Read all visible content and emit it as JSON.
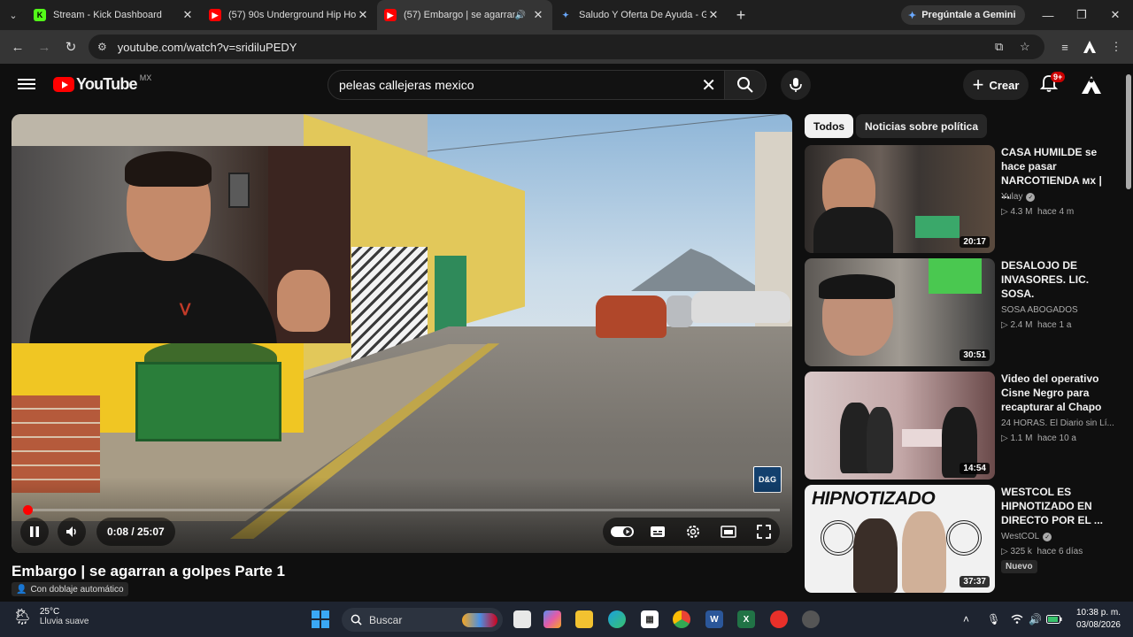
{
  "browser": {
    "tabs": [
      {
        "title": "Stream - Kick Dashboard",
        "favicon": "kick-icon",
        "color": "#53fc18",
        "active": false
      },
      {
        "title": "(57) 90s Underground Hip Hop",
        "favicon": "youtube-icon",
        "color": "#ff0000",
        "active": false
      },
      {
        "title": "(57) Embargo | se agarran a",
        "favicon": "youtube-icon",
        "color": "#ff0000",
        "active": true,
        "audio": true
      },
      {
        "title": "Saludo Y Oferta De Ayuda - Go",
        "favicon": "gemini-icon",
        "color": "#4a90e2",
        "active": false
      }
    ],
    "gemini_label": "Pregúntale a Gemini",
    "url": "youtube.com/watch?v=sridiluPEDY"
  },
  "youtube": {
    "logo_text": "YouTube",
    "country_code": "MX",
    "search_value": "peleas callejeras mexico",
    "create_label": "Crear",
    "notif_badge": "9+"
  },
  "player": {
    "current_time": "0:08",
    "duration": "25:07",
    "time_display": "0:08 / 25:07",
    "progress": 0.005,
    "watermark": "D&G",
    "webcam_shirt_logo": "ᐯ"
  },
  "video": {
    "title": "Embargo | se agarran a golpes Parte 1",
    "dub_label": "Con doblaje automático"
  },
  "sidebar": {
    "chips": [
      "Todos",
      "Noticias sobre política"
    ],
    "recommendations": [
      {
        "title": "CASA HUMILDE se hace pasar NARCOTIENDA ᴍx | ...",
        "channel": "Yulay",
        "verified": true,
        "views": "▷ 4.3 M",
        "age": "hace 4 m",
        "duration": "20:17",
        "new": false
      },
      {
        "title": "DESALOJO DE INVASORES. LIC. SOSA.",
        "channel": "SOSA ABOGADOS",
        "verified": false,
        "views": "▷ 2.4 M",
        "age": "hace 1 a",
        "duration": "30:51",
        "new": false
      },
      {
        "title": "Video del operativo Cisne Negro para recapturar al Chapo",
        "channel": "24 HORAS. El Diario sin Lí...",
        "verified": false,
        "views": "▷ 1.1 M",
        "age": "hace 10 a",
        "duration": "14:54",
        "new": false
      },
      {
        "title": "WESTCOL ES HIPNOTIZADO EN DIRECTO POR EL ...",
        "channel": "WestCOL",
        "verified": true,
        "views": "▷ 325 k",
        "age": "hace 6 días",
        "duration": "37:37",
        "new": true,
        "new_label": "Nuevo",
        "thumb_text": "HIPNOTIZADO"
      }
    ]
  },
  "taskbar": {
    "temp": "25°C",
    "weather": "Lluvia suave",
    "search_label": "Buscar",
    "time": "10:38 p. m.",
    "date": "03/08/2026"
  }
}
